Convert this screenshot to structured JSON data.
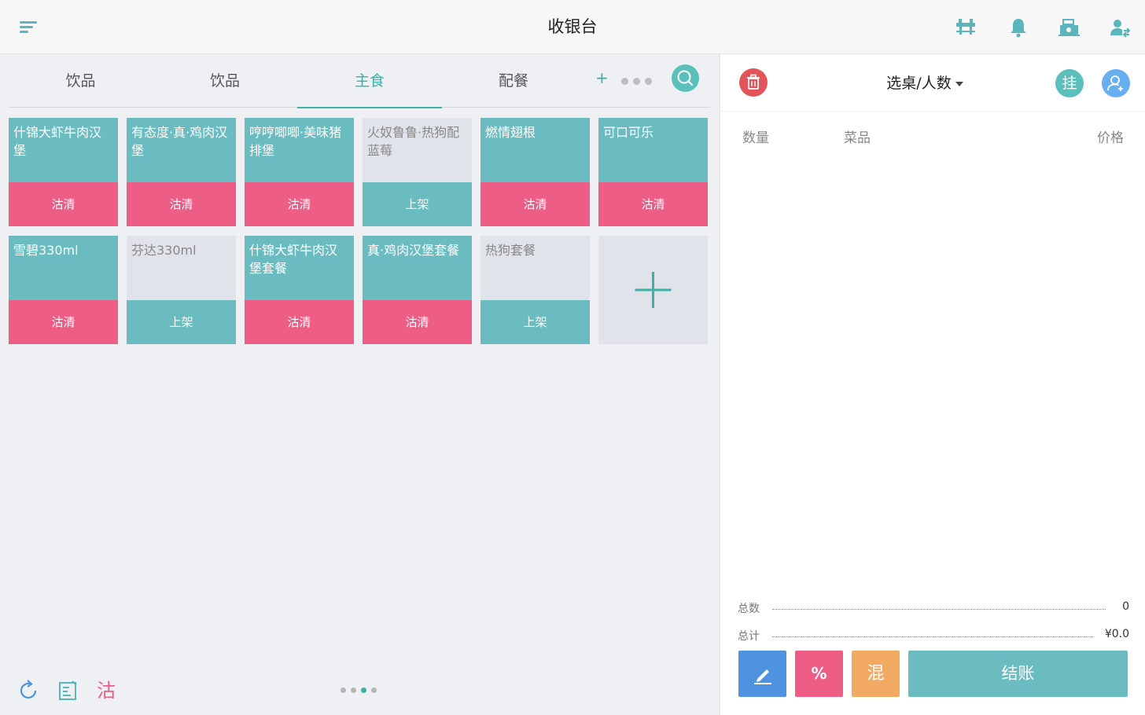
{
  "header": {
    "title": "收银台",
    "icons": [
      "menu-icon",
      "table-icon",
      "bell-icon",
      "cash-register-icon",
      "switch-user-icon"
    ],
    "accent_color": "#5bb5bd"
  },
  "tabs": {
    "items": [
      {
        "label": "饮品",
        "active": false
      },
      {
        "label": "饮品",
        "active": false
      },
      {
        "label": "主食",
        "active": true
      },
      {
        "label": "配餐",
        "active": false
      }
    ],
    "add_label": "+",
    "active_color": "#3ab0a6"
  },
  "products": [
    {
      "name": "什锦大虾牛肉汉堡",
      "status": "沽清",
      "available": true
    },
    {
      "name": "有态度·真·鸡肉汉堡",
      "status": "沽清",
      "available": true
    },
    {
      "name": "哼哼唧唧·美味猪排堡",
      "status": "沽清",
      "available": true
    },
    {
      "name": "火奴鲁鲁·热狗配蓝莓",
      "status": "上架",
      "available": false
    },
    {
      "name": "燃情翅根",
      "status": "沽清",
      "available": true
    },
    {
      "name": "可口可乐",
      "status": "沽清",
      "available": true
    },
    {
      "name": "雪碧330ml",
      "status": "沽清",
      "available": true
    },
    {
      "name": "芬达330ml",
      "status": "上架",
      "available": false
    },
    {
      "name": "什锦大虾牛肉汉堡套餐",
      "status": "沽清",
      "available": true
    },
    {
      "name": "真·鸡肉汉堡套餐",
      "status": "沽清",
      "available": true
    },
    {
      "name": "热狗套餐",
      "status": "上架",
      "available": false
    }
  ],
  "bottom_tools": {
    "icons": [
      "refresh-icon",
      "edit-note-icon",
      "sold-out-icon"
    ],
    "soldout_glyph": "沽",
    "pages": 4,
    "current_page": 3
  },
  "order": {
    "table_select": "选桌/人数",
    "hang_label": "挂",
    "columns": {
      "qty": "数量",
      "dish": "菜品",
      "price": "价格"
    },
    "items": [],
    "total_count_label": "总数",
    "total_count": "0",
    "total_amount_label": "总计",
    "total_amount": "¥0.0"
  },
  "actions": {
    "discount_label": "%",
    "mixed_label": "混",
    "checkout_label": "结账"
  },
  "colors": {
    "soldout": "#ee5d86",
    "onshelf": "#6bbcc1",
    "unavailable": "#e0e3ea",
    "delete": "#e2545a",
    "member": "#6aaef2",
    "edit": "#4f93e0",
    "mixed": "#f2aa62"
  }
}
